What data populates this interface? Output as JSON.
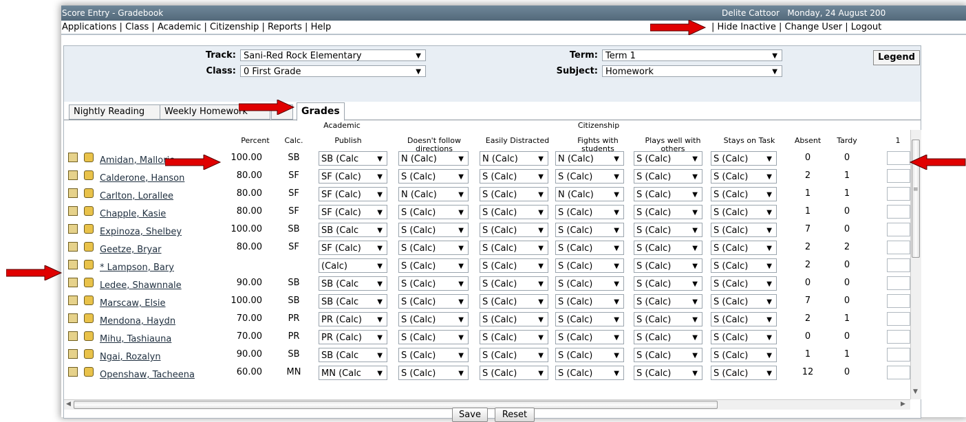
{
  "window": {
    "title": "Score Entry - Gradebook",
    "user": "Delite Cattoor",
    "date": "Monday, 24 August 200"
  },
  "menu": {
    "applications": "Applications",
    "class": "Class",
    "academic": "Academic",
    "citizenship": "Citizenship",
    "reports": "Reports",
    "help": "Help",
    "hide_inactive": "Hide Inactive",
    "change_user": "Change User",
    "logout": "Logout"
  },
  "filters": {
    "track_label": "Track:",
    "track_value": "Sani-Red Rock Elementary",
    "class_label": "Class:",
    "class_value": "0 First Grade",
    "term_label": "Term:",
    "term_value": "Term 1",
    "subject_label": "Subject:",
    "subject_value": "Homework",
    "legend": "Legend"
  },
  "tabs": [
    "Nightly Reading",
    "Weekly Homework",
    "",
    "Grades"
  ],
  "headers": {
    "academic": "Academic",
    "citizenship": "Citizenship",
    "percent": "Percent",
    "calc": "Calc.",
    "publish": "Publish",
    "c1": "Doesn't follow directions",
    "c2": "Easily Distracted",
    "c3": "Fights with students",
    "c4": "Plays well with others",
    "c5": "Stays on Task",
    "absent": "Absent",
    "tardy": "Tardy",
    "score1": "1"
  },
  "students": [
    {
      "name": "Amidan, Mallorie",
      "percent": "100.00",
      "calc": "SB",
      "publish": "SB (Calc",
      "c": [
        "N (Calc)",
        "N (Calc)",
        "N (Calc)",
        "S (Calc)",
        "S (Calc)"
      ],
      "absent": "0",
      "tardy": "0"
    },
    {
      "name": "Calderone, Hanson",
      "percent": "80.00",
      "calc": "SF",
      "publish": "SF (Calc)",
      "c": [
        "S (Calc)",
        "S (Calc)",
        "S (Calc)",
        "S (Calc)",
        "S (Calc)"
      ],
      "absent": "2",
      "tardy": "1"
    },
    {
      "name": "Carlton, Lorallee",
      "percent": "80.00",
      "calc": "SF",
      "publish": "SF (Calc)",
      "c": [
        "N (Calc)",
        "S (Calc)",
        "N (Calc)",
        "S (Calc)",
        "S (Calc)"
      ],
      "absent": "1",
      "tardy": "1"
    },
    {
      "name": "Chapple, Kasie",
      "percent": "80.00",
      "calc": "SF",
      "publish": "SF (Calc)",
      "c": [
        "S (Calc)",
        "S (Calc)",
        "S (Calc)",
        "S (Calc)",
        "S (Calc)"
      ],
      "absent": "1",
      "tardy": "0"
    },
    {
      "name": "Expinoza, Shelbey",
      "percent": "100.00",
      "calc": "SB",
      "publish": "SB (Calc",
      "c": [
        "S (Calc)",
        "S (Calc)",
        "S (Calc)",
        "S (Calc)",
        "S (Calc)"
      ],
      "absent": "7",
      "tardy": "0"
    },
    {
      "name": "Geetze, Bryar",
      "percent": "80.00",
      "calc": "SF",
      "publish": "SF (Calc)",
      "c": [
        "S (Calc)",
        "S (Calc)",
        "S (Calc)",
        "S (Calc)",
        "S (Calc)"
      ],
      "absent": "2",
      "tardy": "2"
    },
    {
      "name": "* Lampson, Bary",
      "percent": "",
      "calc": "",
      "publish": "(Calc)",
      "c": [
        "S (Calc)",
        "S (Calc)",
        "S (Calc)",
        "S (Calc)",
        "S (Calc)"
      ],
      "absent": "2",
      "tardy": "0"
    },
    {
      "name": "Ledee, Shawnnale",
      "percent": "90.00",
      "calc": "SB",
      "publish": "SB (Calc",
      "c": [
        "S (Calc)",
        "S (Calc)",
        "S (Calc)",
        "S (Calc)",
        "S (Calc)"
      ],
      "absent": "0",
      "tardy": "0"
    },
    {
      "name": "Marscaw, Elsie",
      "percent": "100.00",
      "calc": "SB",
      "publish": "SB (Calc",
      "c": [
        "S (Calc)",
        "S (Calc)",
        "S (Calc)",
        "S (Calc)",
        "S (Calc)"
      ],
      "absent": "7",
      "tardy": "0"
    },
    {
      "name": "Mendona, Haydn",
      "percent": "70.00",
      "calc": "PR",
      "publish": "PR (Calc)",
      "c": [
        "S (Calc)",
        "S (Calc)",
        "S (Calc)",
        "S (Calc)",
        "S (Calc)"
      ],
      "absent": "2",
      "tardy": "1"
    },
    {
      "name": "Mihu, Tashiauna",
      "percent": "70.00",
      "calc": "PR",
      "publish": "PR (Calc)",
      "c": [
        "S (Calc)",
        "S (Calc)",
        "S (Calc)",
        "S (Calc)",
        "S (Calc)"
      ],
      "absent": "0",
      "tardy": "0"
    },
    {
      "name": "Ngai, Rozalyn",
      "percent": "90.00",
      "calc": "SB",
      "publish": "SB (Calc",
      "c": [
        "S (Calc)",
        "S (Calc)",
        "S (Calc)",
        "S (Calc)",
        "S (Calc)"
      ],
      "absent": "1",
      "tardy": "1"
    },
    {
      "name": "Openshaw, Tacheena",
      "percent": "60.00",
      "calc": "MN",
      "publish": "MN (Calc",
      "c": [
        "S (Calc)",
        "S (Calc)",
        "S (Calc)",
        "S (Calc)",
        "S (Calc)"
      ],
      "absent": "12",
      "tardy": "0"
    }
  ],
  "buttons": {
    "save": "Save",
    "reset": "Reset"
  },
  "colors": {
    "titlebar": "#5e7587",
    "filter_bg": "#e8eef4",
    "arrow": "#e00000"
  },
  "icons": {
    "row_icon_1": "grade-detail-icon",
    "row_icon_2": "student-photo-icon",
    "dropdown": "chevron-down-icon"
  }
}
